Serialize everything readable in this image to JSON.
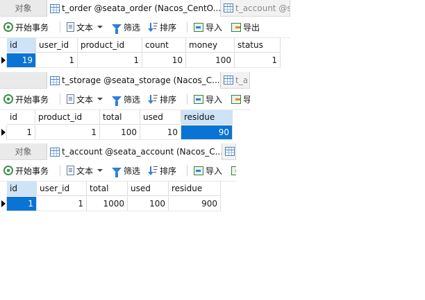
{
  "panels": [
    {
      "object_tab": "对象",
      "active_tab": "t_order @seata_order (Nacos_CentO...",
      "inactive_tab": "t_account @s",
      "toolbar": {
        "begin_transaction": "开始事务",
        "text": "文本",
        "filter": "筛选",
        "sort": "排序",
        "import": "导入",
        "export": "导出"
      },
      "columns": [
        "id",
        "user_id",
        "product_id",
        "count",
        "money",
        "status"
      ],
      "rows": [
        [
          "19",
          "1",
          "1",
          "10",
          "100",
          "1"
        ]
      ]
    },
    {
      "object_tab": "",
      "active_tab": "t_storage @seata_storage (Nacos_C...",
      "inactive_tab": "t_a",
      "toolbar": {
        "begin_transaction": "开始事务",
        "text": "文本",
        "filter": "筛选",
        "sort": "排序",
        "import": "导入",
        "export": "导"
      },
      "columns": [
        "id",
        "product_id",
        "total",
        "used",
        "residue"
      ],
      "rows": [
        [
          "1",
          "1",
          "100",
          "10",
          "90"
        ]
      ]
    },
    {
      "object_tab": "对象",
      "active_tab": "t_account @seata_account (Nacos_C...",
      "inactive_tab": "",
      "toolbar": {
        "begin_transaction": "开始事务",
        "text": "文本",
        "filter": "筛选",
        "sort": "排序",
        "import": "导入",
        "export": ""
      },
      "columns": [
        "id",
        "user_id",
        "total",
        "used",
        "residue"
      ],
      "rows": [
        [
          "1",
          "1",
          "1000",
          "100",
          "900"
        ]
      ]
    }
  ]
}
